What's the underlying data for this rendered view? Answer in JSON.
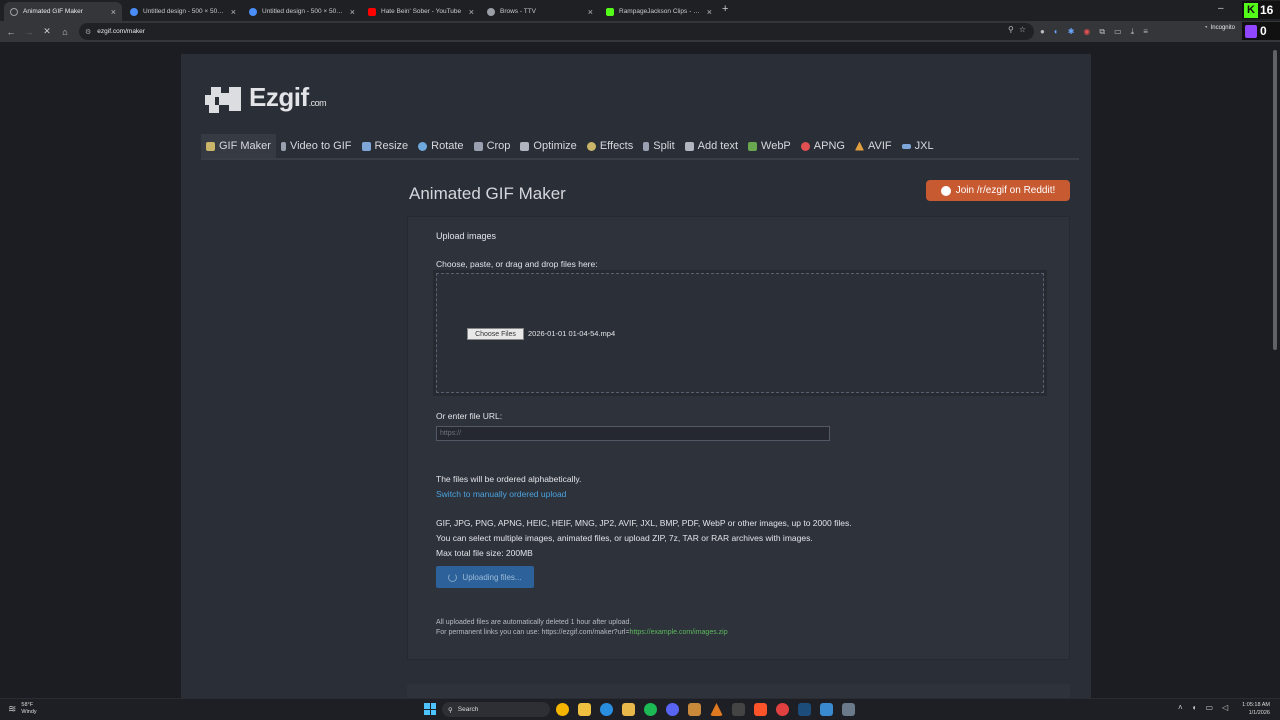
{
  "browser": {
    "tabs": [
      {
        "title": "Animated GIF Maker",
        "active": true,
        "favicon_color": "#9aa0a6"
      },
      {
        "title": "Untitled design - 500 × 500px",
        "active": false,
        "favicon_color": "#4b8df8"
      },
      {
        "title": "Untitled design - 500 × 500px",
        "active": false,
        "favicon_color": "#4b8df8"
      },
      {
        "title": "Hate Bein' Sober - YouTube",
        "active": false,
        "favicon_color": "#ff0000"
      },
      {
        "title": "Brows - TTV",
        "active": false,
        "favicon_color": "#9aa0a6"
      },
      {
        "title": "RampageJackson Clips - Watch",
        "active": false,
        "favicon_color": "#53fc18"
      }
    ],
    "url": "ezgif.com/maker",
    "incognito_label": "Incognito",
    "kick_badge": "16",
    "twitch_badge": "0"
  },
  "site": {
    "logo_text": "Ezgif",
    "logo_suffix": ".com",
    "nav": [
      {
        "label": "GIF Maker",
        "icon": "gif-maker-icon",
        "color": "#c9b46a"
      },
      {
        "label": "Video to GIF",
        "icon": "video-icon",
        "color": "#9aa0b0"
      },
      {
        "label": "Resize",
        "icon": "resize-icon",
        "color": "#7ea6d8"
      },
      {
        "label": "Rotate",
        "icon": "rotate-icon",
        "color": "#6fa8dc"
      },
      {
        "label": "Crop",
        "icon": "crop-icon",
        "color": "#9aa0b0"
      },
      {
        "label": "Optimize",
        "icon": "optimize-icon",
        "color": "#b0b5c0"
      },
      {
        "label": "Effects",
        "icon": "effects-icon",
        "color": "#c9b46a"
      },
      {
        "label": "Split",
        "icon": "split-icon",
        "color": "#9aa0b0"
      },
      {
        "label": "Add text",
        "icon": "add-text-icon",
        "color": "#b0b5c0"
      },
      {
        "label": "WebP",
        "icon": "webp-icon",
        "color": "#6aa84f"
      },
      {
        "label": "APNG",
        "icon": "apng-icon",
        "color": "#e05050"
      },
      {
        "label": "AVIF",
        "icon": "avif-icon",
        "color": "#e0a040"
      },
      {
        "label": "JXL",
        "icon": "jxl-icon",
        "color": "#7ea6d8"
      }
    ],
    "page_title": "Animated GIF Maker",
    "reddit_button": "Join /r/ezgif on Reddit!"
  },
  "form": {
    "legend": "Upload images",
    "choose_label": "Choose, paste, or drag and drop files here:",
    "choose_button": "Choose Files",
    "file_name": "2026-01-01 01-04-54.mp4",
    "url_label": "Or enter file URL:",
    "url_placeholder": "https://",
    "order_note": "The files will be ordered alphabetically.",
    "manual_link": "Switch to manually ordered upload",
    "formats_line1": "GIF, JPG, PNG, APNG, HEIC, HEIF, MNG, JP2, AVIF, JXL, BMP, PDF, WebP or other images, up to 2000 files.",
    "formats_line2": "You can select multiple images, animated files, or upload ZIP, 7z, TAR or RAR archives with images.",
    "max_size": "Max total file size: 200MB",
    "upload_button": "Uploading files...",
    "delete_note": "All uploaded files are automatically deleted 1 hour after upload.",
    "permalink_note": "For permanent links you can use: https://ezgif.com/maker?url=",
    "permalink_example": "https://example.com/images.zip"
  },
  "taskbar": {
    "weather_temp": "58°F",
    "weather_desc": "Windy",
    "search_label": "Search",
    "time": "1:05:18 AM",
    "date": "1/1/2026",
    "apps": [
      {
        "name": "chrome-icon",
        "color": "#f4b400"
      },
      {
        "name": "file-explorer-icon",
        "color": "#f0c040"
      },
      {
        "name": "edge-icon",
        "color": "#2a8ee0"
      },
      {
        "name": "folder-icon",
        "color": "#e8b84a"
      },
      {
        "name": "spotify-icon",
        "color": "#1db954"
      },
      {
        "name": "discord-icon",
        "color": "#5865f2"
      },
      {
        "name": "obsidian-icon",
        "color": "#c88a3a"
      },
      {
        "name": "vlc-icon",
        "color": "#e07a20"
      },
      {
        "name": "terminal-icon",
        "color": "#444"
      },
      {
        "name": "brave-icon",
        "color": "#fb542b"
      },
      {
        "name": "screenshot-icon",
        "color": "#e04040"
      },
      {
        "name": "steam-icon",
        "color": "#1b4c7a"
      },
      {
        "name": "photos-icon",
        "color": "#3a8ad0"
      },
      {
        "name": "capture-icon",
        "color": "#6a7a8a"
      }
    ]
  }
}
